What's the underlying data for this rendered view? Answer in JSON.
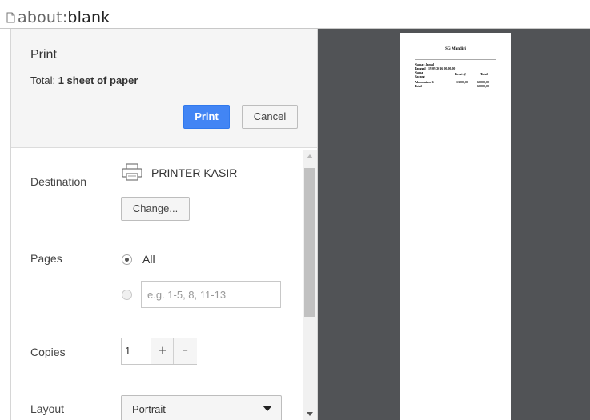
{
  "browser": {
    "url_prefix": "about:",
    "url_rest": "blank"
  },
  "print_dialog": {
    "title": "Print",
    "total_label": "Total:",
    "total_value": "1 sheet of paper",
    "print_button": "Print",
    "cancel_button": "Cancel",
    "destination": {
      "label": "Destination",
      "printer": "PRINTER KASIR",
      "change_button": "Change..."
    },
    "pages": {
      "label": "Pages",
      "all_label": "All",
      "custom_placeholder": "e.g. 1-5, 8, 11-13",
      "selected": "All"
    },
    "copies": {
      "label": "Copies",
      "value": "1",
      "plus": "+",
      "minus": "–"
    },
    "layout": {
      "label": "Layout",
      "value": "Portrait"
    }
  },
  "preview": {
    "store": "SG Mandiri",
    "nama": "Nama : Jamal",
    "tanggal": "Tanggal : 19/09/2016 00.00.00",
    "col_nama": "Nama",
    "col_barang": "Barang",
    "col_berat": "Berat @",
    "col_total": "Total",
    "item_name": "Alumunium 6",
    "item_price": "13000,00",
    "item_total": "66000,00",
    "total_label": "Total",
    "total_value": "66000,00"
  },
  "colors": {
    "accent": "#4285f4",
    "preview_bg": "#515356",
    "header_bg": "#f5f5f5"
  },
  "icons": {
    "page": "page-icon",
    "printer": "printer-icon"
  }
}
